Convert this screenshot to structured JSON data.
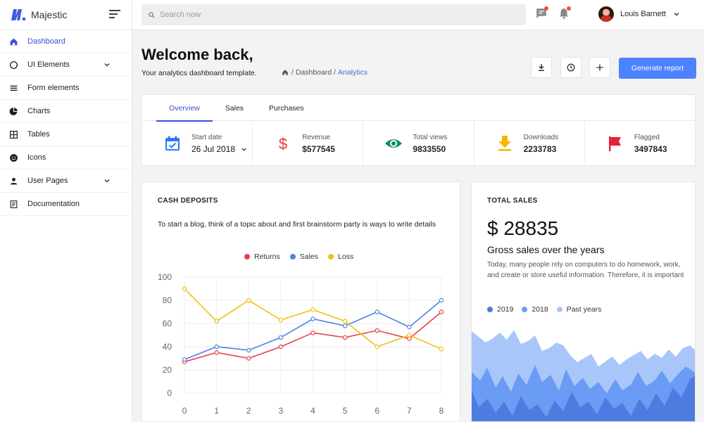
{
  "brand": {
    "name": "Majestic"
  },
  "search": {
    "placeholder": "Search now"
  },
  "user": {
    "name": "Louis Barnett"
  },
  "sidebar": {
    "items": [
      {
        "label": "Dashboard",
        "icon": "home-icon"
      },
      {
        "label": "UI Elements",
        "icon": "circle-icon"
      },
      {
        "label": "Form elements",
        "icon": "list-icon"
      },
      {
        "label": "Charts",
        "icon": "pie-chart-icon"
      },
      {
        "label": "Tables",
        "icon": "table-icon"
      },
      {
        "label": "Icons",
        "icon": "emoji-icon"
      },
      {
        "label": "User Pages",
        "icon": "user-icon"
      },
      {
        "label": "Documentation",
        "icon": "document-icon"
      }
    ]
  },
  "header": {
    "title": "Welcome back,",
    "subtitle": "Your analytics dashboard template.",
    "breadcrumb": [
      "/ Dashboard /",
      "Analytics"
    ],
    "generate_label": "Generate report"
  },
  "overview": {
    "tabs": [
      "Overview",
      "Sales",
      "Purchases"
    ],
    "stats": [
      {
        "label": "Start date",
        "value": "26 Jul 2018",
        "icon": "calendar-icon",
        "color": "#2979ff"
      },
      {
        "label": "Revenue",
        "value": "$577545",
        "icon": "dollar-icon",
        "color": "#e53935"
      },
      {
        "label": "Total views",
        "value": "9833550",
        "icon": "eye-icon",
        "color": "#0a8f5a"
      },
      {
        "label": "Downloads",
        "value": "2233783",
        "icon": "download-icon",
        "color": "#f4b400"
      },
      {
        "label": "Flagged",
        "value": "3497843",
        "icon": "flag-icon",
        "color": "#e8203a"
      }
    ]
  },
  "cash": {
    "title": "CASH DEPOSITS",
    "description": "To start a blog, think of a topic about and first brainstorm party is ways to write details"
  },
  "total_sales": {
    "title": "TOTAL SALES",
    "amount": "$ 28835",
    "heading": "Gross sales over the years",
    "description": "Today, many people rely on computers to do homework, work, and create or store useful information. Therefore, it is important",
    "legend": [
      {
        "name": "2019",
        "color": "#4d7be0"
      },
      {
        "name": "2018",
        "color": "#6a9cf5"
      },
      {
        "name": "Past years",
        "color": "#a9c6fb"
      }
    ]
  },
  "chart_data": {
    "type": "line",
    "x": [
      0,
      1,
      2,
      3,
      4,
      5,
      6,
      7,
      8
    ],
    "ylim": [
      0,
      100
    ],
    "yticks": [
      0,
      20,
      40,
      60,
      80,
      100
    ],
    "grid": true,
    "legend_position": "top-center",
    "series": [
      {
        "name": "Returns",
        "color": "#e9404e",
        "values": [
          27,
          35,
          30,
          40,
          52,
          48,
          54,
          47,
          70
        ]
      },
      {
        "name": "Sales",
        "color": "#4a84e3",
        "values": [
          29,
          40,
          37,
          48,
          64,
          58,
          70,
          57,
          80
        ]
      },
      {
        "name": "Loss",
        "color": "#f2c012",
        "values": [
          90,
          62,
          80,
          63,
          72,
          62,
          40,
          50,
          38
        ]
      }
    ]
  }
}
